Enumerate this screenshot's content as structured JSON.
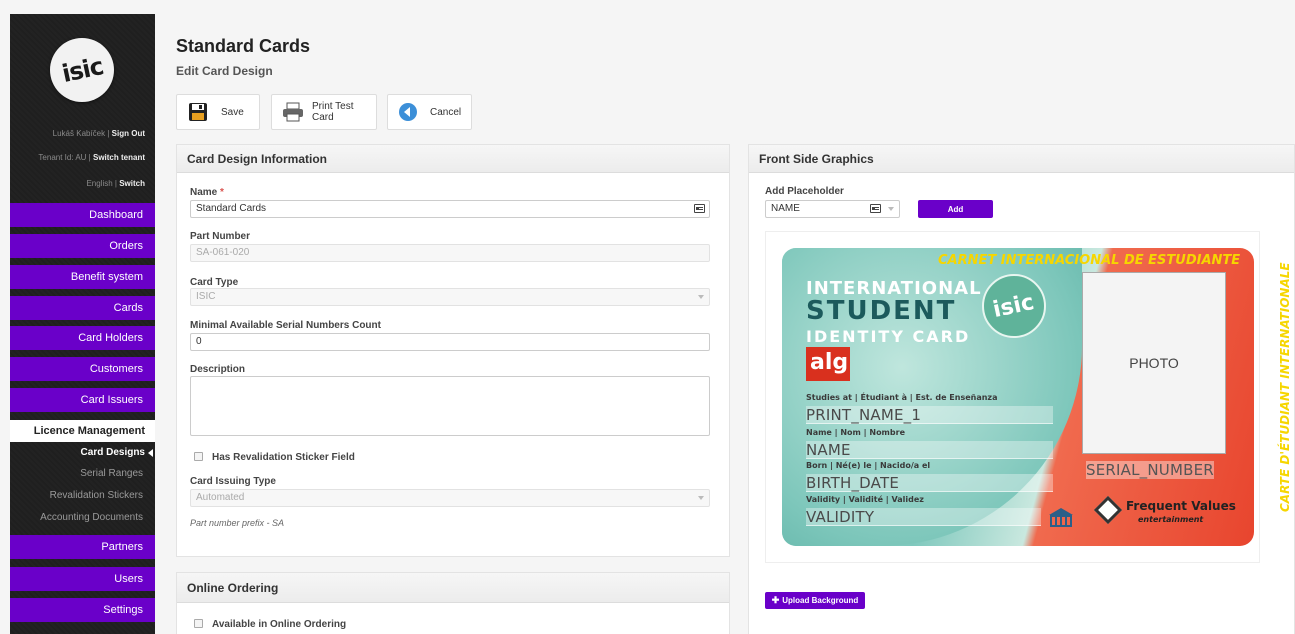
{
  "sidebar": {
    "logo_text": "isic",
    "user": {
      "name": "Lukáš Kabíček",
      "sep": " | ",
      "action": "Sign Out"
    },
    "tenant": {
      "text": "Tenant Id: AU",
      "sep": " | ",
      "action": "Switch tenant"
    },
    "language": {
      "text": "English",
      "sep": " | ",
      "action": "Switch"
    },
    "nav": [
      "Dashboard",
      "Orders",
      "Benefit system",
      "Cards",
      "Card Holders",
      "Customers",
      "Card Issuers"
    ],
    "active_section": "Licence Management",
    "sub_items": [
      "Card Designs",
      "Serial Ranges",
      "Revalidation Stickers",
      "Accounting Documents"
    ],
    "nav_bottom": [
      "Partners",
      "Users",
      "Settings"
    ],
    "accent": "#6a00c9"
  },
  "header": {
    "title": "Standard Cards",
    "subtitle": "Edit Card Design",
    "buttons": {
      "save": "Save",
      "print": "Print Test Card",
      "cancel": "Cancel"
    }
  },
  "info_panel": {
    "title": "Card Design Information",
    "name_label": "Name",
    "name_required": "*",
    "name_value": "Standard Cards",
    "part_number_label": "Part Number",
    "part_number_value": "SA-061-020",
    "card_type_label": "Card Type",
    "card_type_value": "ISIC",
    "min_serial_label": "Minimal Available Serial Numbers Count",
    "min_serial_value": "0",
    "description_label": "Description",
    "description_value": "",
    "revalidation_label": "Has Revalidation Sticker Field",
    "issuing_type_label": "Card Issuing Type",
    "issuing_type_value": "Automated",
    "prefix_note": "Part number prefix - SA"
  },
  "online_panel": {
    "title": "Online Ordering",
    "available_label": "Available in Online Ordering"
  },
  "front_panel": {
    "title": "Front Side Graphics",
    "placeholder_label": "Add Placeholder",
    "placeholder_value": "NAME",
    "add_button": "Add",
    "upload_button": "Upload Background"
  },
  "card": {
    "banner_top": "CARNET INTERNACIONAL DE ESTUDIANTE",
    "banner_side": "CARTE D'ÉTUDIANT INTERNATIONALE",
    "line1": "INTERNATIONAL",
    "line2": "STUDENT",
    "line3": "IDENTITY CARD",
    "logo": "isic",
    "issuer_logo": "alg",
    "studies_label": "Studies at | Étudiant à | Est. de Enseñanza",
    "print_name": "PRINT_NAME_1",
    "name_label": "Name | Nom | Nombre",
    "name_value": "NAME",
    "born_label": "Born | Né(e) le | Nacido/a el",
    "birth_value": "BIRTH_DATE",
    "validity_label": "Validity | Validité | Validez",
    "validity_value": "VALIDITY",
    "photo": "PHOTO",
    "serial": "SERIAL_NUMBER",
    "partner": "Frequent Values",
    "partner_sub": "entertainment"
  }
}
